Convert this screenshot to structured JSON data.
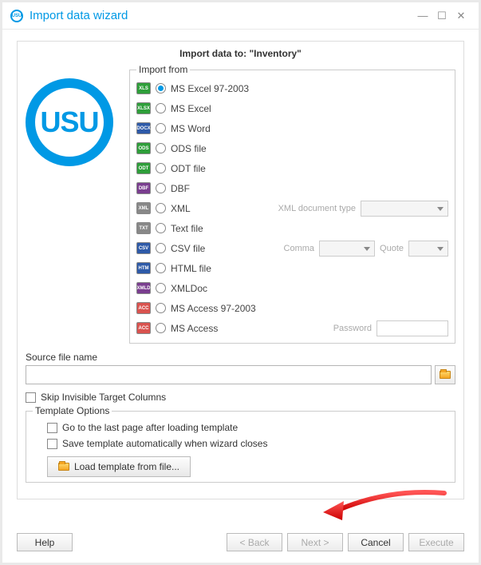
{
  "window": {
    "title": "Import data wizard"
  },
  "panel": {
    "heading": "Import data to: \"Inventory\""
  },
  "logo": {
    "text": "USU"
  },
  "import_from": {
    "legend": "Import from",
    "items": [
      {
        "label": "MS Excel 97-2003",
        "checked": true,
        "icon_bg": "#2e9e3a",
        "icon_text": "XLS"
      },
      {
        "label": "MS Excel",
        "checked": false,
        "icon_bg": "#2e9e3a",
        "icon_text": "XLSX"
      },
      {
        "label": "MS Word",
        "checked": false,
        "icon_bg": "#2e5aa8",
        "icon_text": "DOCX"
      },
      {
        "label": "ODS file",
        "checked": false,
        "icon_bg": "#2e9e3a",
        "icon_text": "ODS"
      },
      {
        "label": "ODT file",
        "checked": false,
        "icon_bg": "#2e9e3a",
        "icon_text": "ODT"
      },
      {
        "label": "DBF",
        "checked": false,
        "icon_bg": "#7a3e8f",
        "icon_text": "DBF"
      },
      {
        "label": "XML",
        "checked": false,
        "icon_bg": "#888888",
        "icon_text": "XML",
        "extra": {
          "label": "XML document type",
          "type": "dropdown",
          "width": 110
        }
      },
      {
        "label": "Text file",
        "checked": false,
        "icon_bg": "#888888",
        "icon_text": "TXT"
      },
      {
        "label": "CSV file",
        "checked": false,
        "icon_bg": "#2e5aa8",
        "icon_text": "CSV",
        "extra": {
          "dual": true,
          "label1": "Comma",
          "w1": 70,
          "label2": "Quote",
          "w2": 50
        }
      },
      {
        "label": "HTML file",
        "checked": false,
        "icon_bg": "#2e5aa8",
        "icon_text": "HTM"
      },
      {
        "label": "XMLDoc",
        "checked": false,
        "icon_bg": "#7a3e8f",
        "icon_text": "XMLD"
      },
      {
        "label": "MS Access 97-2003",
        "checked": false,
        "icon_bg": "#d9534f",
        "icon_text": "ACC"
      },
      {
        "label": "MS Access",
        "checked": false,
        "icon_bg": "#d9534f",
        "icon_text": "ACC",
        "extra": {
          "label": "Password",
          "type": "text",
          "width": 90
        }
      }
    ]
  },
  "source": {
    "label": "Source file name",
    "value": ""
  },
  "skip_invisible": {
    "label": "Skip Invisible Target Columns",
    "checked": false
  },
  "template": {
    "legend": "Template Options",
    "opt1": {
      "label": "Go to the last page after loading template",
      "checked": false
    },
    "opt2": {
      "label": "Save template automatically when wizard closes",
      "checked": false
    },
    "load_btn": "Load template from file..."
  },
  "footer": {
    "help": "Help",
    "back": "< Back",
    "next": "Next >",
    "cancel": "Cancel",
    "execute": "Execute"
  }
}
